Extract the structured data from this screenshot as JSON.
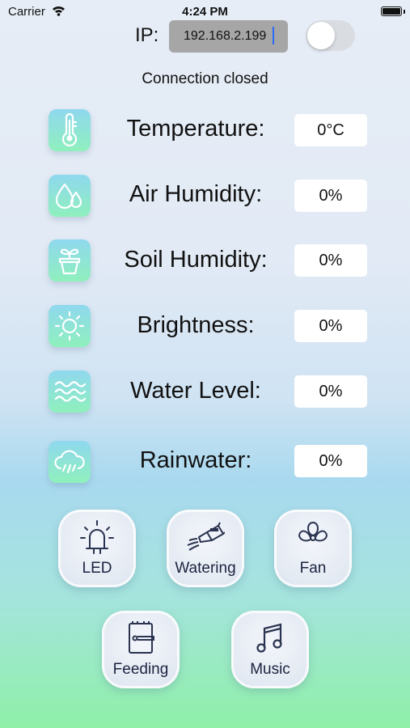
{
  "status_bar": {
    "carrier": "Carrier",
    "time": "4:24 PM"
  },
  "connection": {
    "ip_label": "IP:",
    "ip_value": "192.168.2.199",
    "toggle_on": false,
    "status_text": "Connection closed"
  },
  "sensors": [
    {
      "label": "Temperature:",
      "value": "0°C",
      "icon": "thermometer-icon"
    },
    {
      "label": "Air Humidity:",
      "value": "0%",
      "icon": "water-drops-icon"
    },
    {
      "label": "Soil Humidity:",
      "value": "0%",
      "icon": "plant-pot-icon"
    },
    {
      "label": "Brightness:",
      "value": "0%",
      "icon": "sun-icon"
    },
    {
      "label": "Water Level:",
      "value": "0%",
      "icon": "waves-icon"
    },
    {
      "label": "Rainwater:",
      "value": "0%",
      "icon": "rain-cloud-icon"
    }
  ],
  "actions": [
    {
      "label": "LED",
      "icon": "led-icon"
    },
    {
      "label": "Watering",
      "icon": "watering-can-icon"
    },
    {
      "label": "Fan",
      "icon": "fan-icon"
    },
    {
      "label": "Feeding",
      "icon": "feeder-icon"
    },
    {
      "label": "Music",
      "icon": "music-note-icon"
    }
  ],
  "colors": {
    "icon_gradient_top": "#8fd8ee",
    "icon_gradient_bottom": "#8ff0bd",
    "caret": "#2b6cf6",
    "input_bg": "#a6a6a6"
  }
}
